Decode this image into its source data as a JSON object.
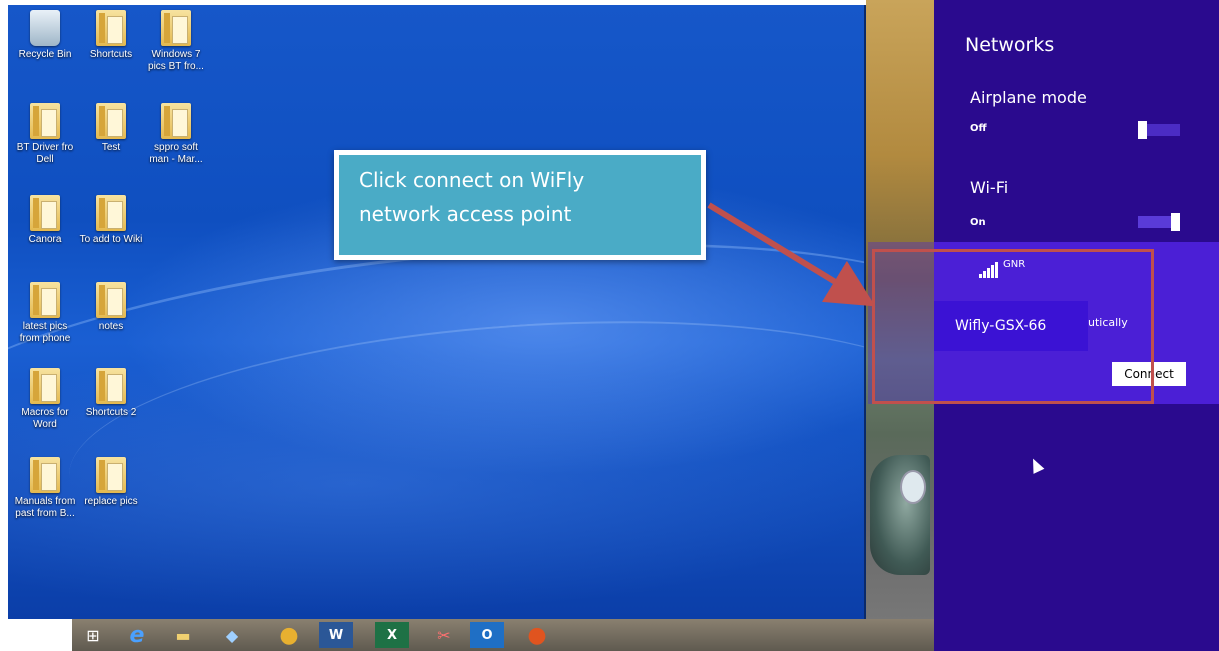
{
  "desktop_icons": [
    {
      "label": "Recycle Bin",
      "icon": "recycle-bin-icon"
    },
    {
      "label": "Shortcuts",
      "icon": "folder-icon"
    },
    {
      "label": "Windows 7 pics BT fro...",
      "icon": "folder-icon"
    },
    {
      "label": "BT Driver fro Dell",
      "icon": "folder-icon"
    },
    {
      "label": "Test",
      "icon": "folder-icon"
    },
    {
      "label": "sppro soft man - Mar...",
      "icon": "folder-icon"
    },
    {
      "label": "Canora",
      "icon": "folder-icon"
    },
    {
      "label": "To add to Wiki",
      "icon": "folder-icon"
    },
    {
      "label": "latest pics from phone",
      "icon": "folder-icon"
    },
    {
      "label": "notes",
      "icon": "folder-icon"
    },
    {
      "label": "Macros for Word",
      "icon": "folder-icon"
    },
    {
      "label": "Shortcuts 2",
      "icon": "folder-icon"
    },
    {
      "label": "Manuals from past from B...",
      "icon": "folder-icon"
    },
    {
      "label": "replace pics",
      "icon": "folder-icon"
    }
  ],
  "taskbar": {
    "items": [
      {
        "icon": "windows-start-icon",
        "glyph": "⊞"
      },
      {
        "icon": "internet-explorer-icon",
        "glyph": "e"
      },
      {
        "icon": "file-explorer-icon",
        "glyph": "▬"
      },
      {
        "icon": "notebook-icon",
        "glyph": "◆"
      },
      {
        "icon": "chrome-icon",
        "glyph": "●"
      },
      {
        "icon": "word-icon",
        "glyph": "W"
      },
      {
        "icon": "excel-icon",
        "glyph": "X"
      },
      {
        "icon": "snipping-tool-icon",
        "glyph": "✂"
      },
      {
        "icon": "outlook-icon",
        "glyph": "O"
      },
      {
        "icon": "firefox-icon",
        "glyph": "●"
      }
    ]
  },
  "networks_panel": {
    "title": "Networks",
    "airplane_mode": {
      "label": "Airplane mode",
      "state": "Off"
    },
    "wifi": {
      "label": "Wi-Fi",
      "state": "On"
    },
    "network": {
      "name": "GNR",
      "connect_automatically_text": "utically",
      "connect_label": "Connect"
    }
  },
  "overlay": {
    "wifly_label": "Wifly-GSX-66",
    "annotation_line1": "Click connect on WiFly",
    "annotation_line2": "network access point"
  },
  "colors": {
    "panel_bg": "#2a0a8e",
    "network_item_bg": "#4b1fd6",
    "annotation_bg": "#4aabc6",
    "highlight": "#c0504d",
    "desktop_blue": "#1657c9"
  }
}
